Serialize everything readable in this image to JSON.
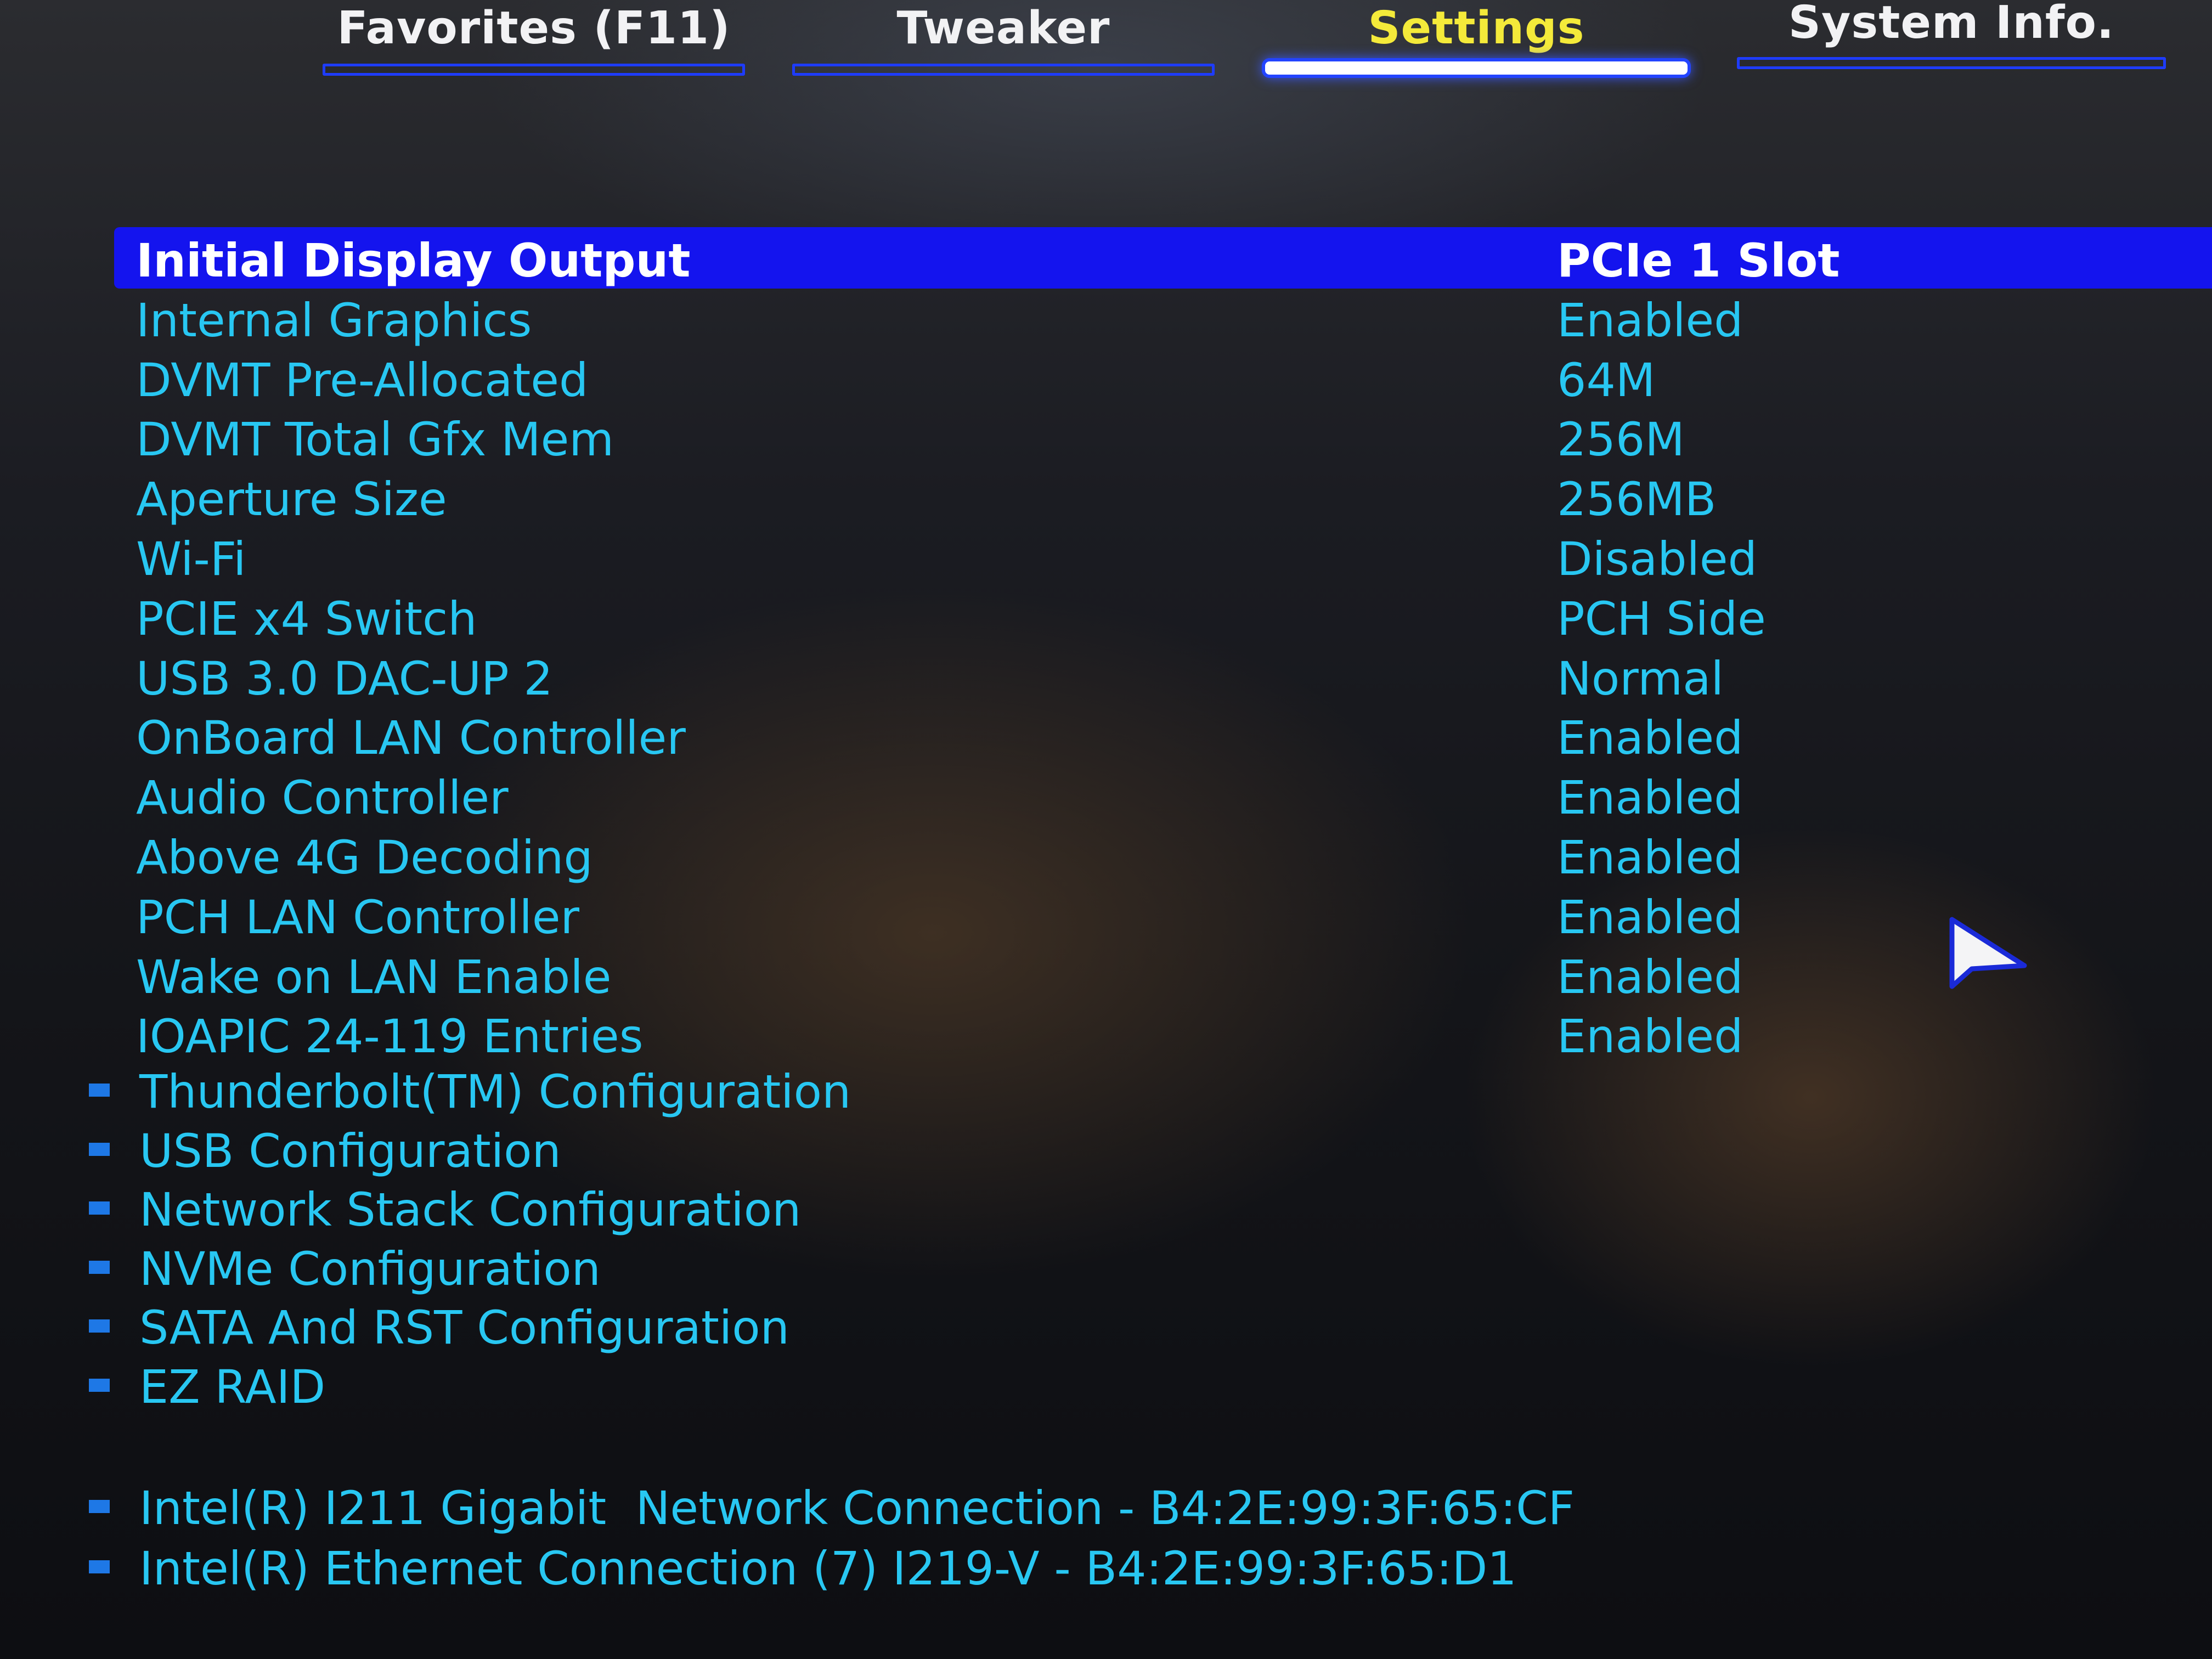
{
  "tabs": [
    {
      "label": "Favorites (F11)",
      "active": false
    },
    {
      "label": "Tweaker",
      "active": false
    },
    {
      "label": "Settings",
      "active": true
    },
    {
      "label": "System Info.",
      "active": false
    }
  ],
  "settings": [
    {
      "label": "Initial Display Output",
      "value": "PCIe 1 Slot",
      "selected": true
    },
    {
      "label": "Internal Graphics",
      "value": "Enabled"
    },
    {
      "label": "DVMT Pre-Allocated",
      "value": "64M"
    },
    {
      "label": "DVMT Total Gfx Mem",
      "value": "256M"
    },
    {
      "label": "Aperture Size",
      "value": "256MB"
    },
    {
      "label": "Wi-Fi",
      "value": "Disabled"
    },
    {
      "label": "PCIE x4 Switch",
      "value": "PCH Side"
    },
    {
      "label": "USB 3.0 DAC-UP 2",
      "value": "Normal"
    },
    {
      "label": "OnBoard LAN Controller",
      "value": "Enabled"
    },
    {
      "label": "Audio Controller",
      "value": "Enabled"
    },
    {
      "label": "Above 4G Decoding",
      "value": "Enabled"
    },
    {
      "label": "PCH LAN Controller",
      "value": "Enabled"
    },
    {
      "label": "Wake on LAN Enable",
      "value": "Enabled"
    },
    {
      "label": "IOAPIC 24-119 Entries",
      "value": "Enabled"
    }
  ],
  "submenus": [
    {
      "label": "Thunderbolt(TM) Configuration"
    },
    {
      "label": "USB Configuration"
    },
    {
      "label": "Network Stack Configuration"
    },
    {
      "label": "NVMe Configuration"
    },
    {
      "label": "SATA And RST Configuration"
    },
    {
      "label": "EZ RAID"
    }
  ],
  "network_devices": [
    {
      "label": "Intel(R) I211 Gigabit  Network Connection - B4:2E:99:3F:65:CF"
    },
    {
      "label": "Intel(R) Ethernet Connection (7) I219-V - B4:2E:99:3F:65:D1"
    }
  ],
  "colors": {
    "accent": "#1414ee",
    "item_text": "#28c7f2",
    "active_tab_text": "#f4ea3a",
    "tab_text": "#f2f2f4",
    "bullet": "#1e78e6"
  },
  "icons": {
    "submenu_bullet": "square-bullet-icon",
    "pointer": "mouse-cursor-icon"
  }
}
